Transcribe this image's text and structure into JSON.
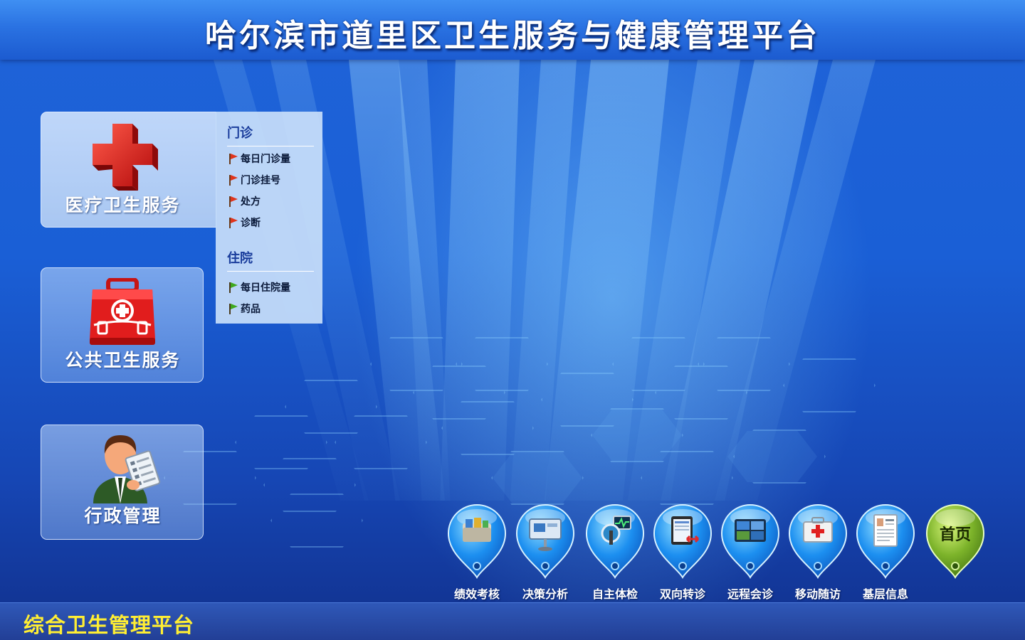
{
  "header": {
    "title": "哈尔滨市道里区卫生服务与健康管理平台"
  },
  "left_menu": {
    "cards": [
      {
        "label": "医疗卫生服务",
        "icon": "red-cross-icon"
      },
      {
        "label": "公共卫生服务",
        "icon": "medical-kit-icon"
      },
      {
        "label": "行政管理",
        "icon": "administrator-icon"
      }
    ]
  },
  "submenu": {
    "sections": [
      {
        "title": "门诊",
        "items": [
          "每日门诊量",
          "门诊挂号",
          "处方",
          "诊断"
        ],
        "flag_color": "#e0341c"
      },
      {
        "title": "住院",
        "items": [
          "每日住院量",
          "药品"
        ],
        "flag_color": "#3fa81c"
      }
    ]
  },
  "dock": {
    "items": [
      {
        "label": "绩效考核",
        "icon": "performance-folder-icon"
      },
      {
        "label": "决策分析",
        "icon": "presentation-board-icon"
      },
      {
        "label": "自主体检",
        "icon": "health-monitor-icon"
      },
      {
        "label": "双向转诊",
        "icon": "referral-tablet-icon"
      },
      {
        "label": "远程会诊",
        "icon": "remote-consultation-icon"
      },
      {
        "label": "移动随访",
        "icon": "first-aid-case-icon"
      },
      {
        "label": "基层信息",
        "icon": "resume-document-icon"
      }
    ],
    "home": {
      "label": "首页",
      "icon": "home-pin-icon"
    }
  },
  "footer": {
    "title": "综合卫生管理平台"
  },
  "colors": {
    "header_blue": "#2a72e2",
    "footer_yellow": "#ffee33",
    "home_green": "#6aa31c"
  }
}
